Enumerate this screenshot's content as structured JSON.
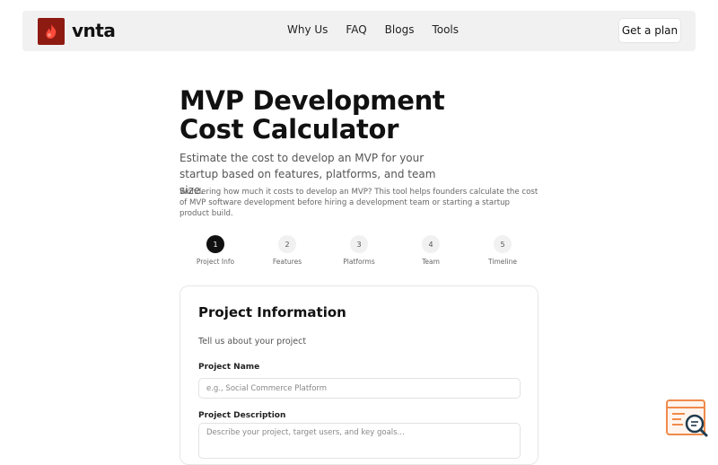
{
  "nav": {
    "brand": "vnta",
    "links": [
      "Why Us",
      "FAQ",
      "Blogs",
      "Tools"
    ],
    "cta_label": "Get a plan"
  },
  "hero": {
    "title_line1": "MVP Development",
    "title_line2": "Cost Calculator",
    "subtitle": "Estimate the cost to develop an MVP for your startup based on features, platforms, and team size.",
    "description": "Wondering how much it costs to develop an MVP? This tool helps founders calculate the cost of MVP software development before hiring a development team or starting a startup product build."
  },
  "steps": [
    {
      "number": "1",
      "label": "Project Info",
      "active": true
    },
    {
      "number": "2",
      "label": "Features",
      "active": false
    },
    {
      "number": "3",
      "label": "Platforms",
      "active": false
    },
    {
      "number": "4",
      "label": "Team",
      "active": false
    },
    {
      "number": "5",
      "label": "Timeline",
      "active": false
    }
  ],
  "form": {
    "title": "Project Information",
    "subtitle": "Tell us about your project",
    "project_name_label": "Project Name",
    "project_name_placeholder": "e.g., Social Commerce Platform",
    "project_name_value": "",
    "project_description_label": "Project Description",
    "project_description_placeholder": "Describe your project, target users, and key goals...",
    "project_description_value": ""
  },
  "colors": {
    "brand_accent": "#8e1b12",
    "active_step": "#111111",
    "float_button_orange": "#f08a4b"
  },
  "icons": {
    "logo": "flame-logo-icon",
    "floating_button": "search-window-icon"
  }
}
